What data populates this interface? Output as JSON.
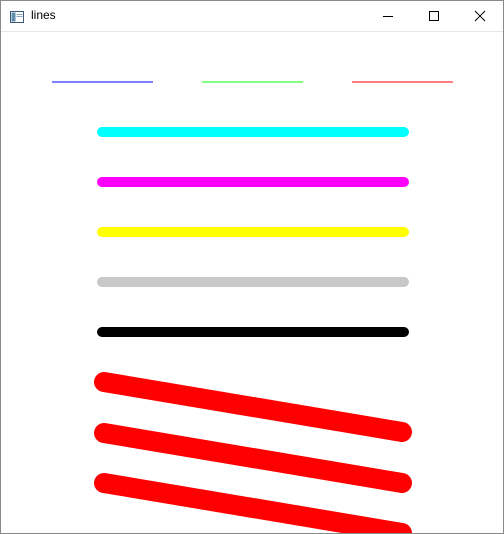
{
  "window": {
    "title": "lines",
    "icon": "app-window-icon"
  },
  "caption_buttons": [
    {
      "name": "minimize-icon"
    },
    {
      "name": "maximize-icon"
    },
    {
      "name": "close-icon"
    }
  ],
  "drawing": {
    "thin_lines": [
      {
        "name": "thin-line-blue",
        "color": "#0000ff"
      },
      {
        "name": "thin-line-green",
        "color": "#00ff00"
      },
      {
        "name": "thin-line-red",
        "color": "#ff0000"
      }
    ],
    "thick_lines": [
      {
        "name": "thick-line-cyan",
        "color": "#00ffff"
      },
      {
        "name": "thick-line-magenta",
        "color": "#ff00ff"
      },
      {
        "name": "thick-line-yellow",
        "color": "#ffff00"
      },
      {
        "name": "thick-line-gray",
        "color": "#c8c8c8"
      },
      {
        "name": "thick-line-black",
        "color": "#000000"
      }
    ],
    "diagonal_lines": [
      {
        "name": "diagonal-line-1",
        "color": "#ff0000"
      },
      {
        "name": "diagonal-line-2",
        "color": "#ff0000"
      },
      {
        "name": "diagonal-line-3",
        "color": "#ff0000"
      }
    ]
  }
}
